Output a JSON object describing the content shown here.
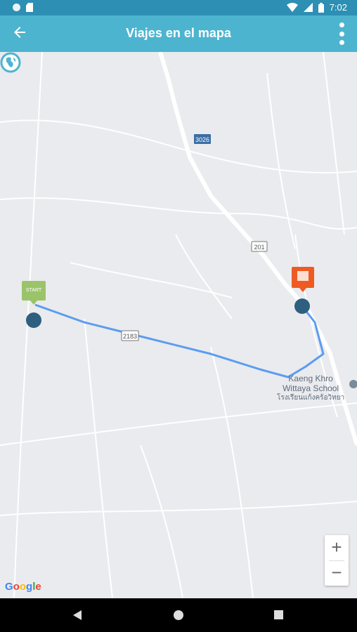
{
  "status_bar": {
    "time": "7:02"
  },
  "app_bar": {
    "title": "Viajes en el mapa"
  },
  "map": {
    "road_labels": [
      "3026",
      "201",
      "2183"
    ],
    "poi": {
      "name_en_1": "Kaeng Khro",
      "name_en_2": "Wittaya School",
      "name_th": "โรงเรียนแก้งคร้อวิทยา"
    },
    "start_marker_label": "START",
    "route_color": "#5b9cf2",
    "stop_color": "#2e5f7e",
    "finish_color": "#ef5a22",
    "start_color": "#9bc46a",
    "zoom_in": "+",
    "zoom_out": "−",
    "attribution": {
      "G": "G",
      "o1": "o",
      "o2": "o",
      "g": "g",
      "l": "l",
      "e": "e"
    }
  },
  "icons": {
    "back": "arrow-left-icon",
    "more": "more-vert-icon",
    "globe": "globe-icon"
  }
}
